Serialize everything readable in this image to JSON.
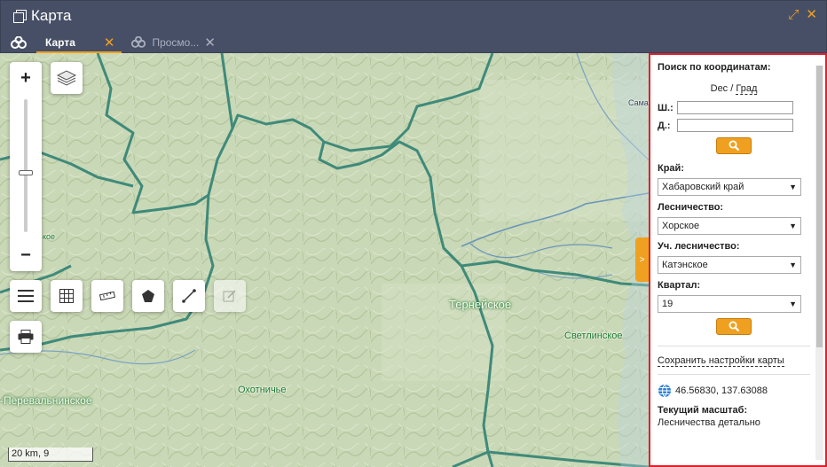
{
  "window": {
    "title": "Карта",
    "maximize_icon": "maximize-icon",
    "close_icon": "close-icon"
  },
  "tabs": [
    {
      "label": "Карта",
      "active": true
    },
    {
      "label": "Просмо...",
      "active": false
    }
  ],
  "map": {
    "places": {
      "ternejskoe": "Тернейское",
      "svetlinskoe": "Светлинское",
      "okhotnichye": "Охотничье",
      "perevalninskoe": "-Перевальнинское",
      "samarginskoe": "Самаргинс",
      "left_fragment": "кое"
    },
    "scale_label": "20 km, 9",
    "zoom_in": "+",
    "zoom_out": "−",
    "colors": {
      "terrain": "#c9d8b6",
      "boundary": "#3f8a7a",
      "river": "#6a97b8"
    }
  },
  "panel": {
    "coord_search_title": "Поиск по координатам:",
    "format_dec": "Dec",
    "format_sep": "/",
    "format_grad": "Град",
    "lat_label": "Ш.:",
    "lon_label": "Д.:",
    "lat_value": "",
    "lon_value": "",
    "region_label": "Край:",
    "region_value": "Хабаровский край",
    "forestry_label": "Лесничество:",
    "forestry_value": "Хорское",
    "district_label": "Уч. лесничество:",
    "district_value": "Катэнское",
    "quarter_label": "Квартал:",
    "quarter_value": "19",
    "save_settings": "Сохранить настройки карты",
    "cursor_coords": "46.56830, 137.63088",
    "current_scale_label": "Текущий масштаб:",
    "current_scale_value": "Лесничества детально",
    "toggle_label": ">",
    "accent": "#f0a020",
    "highlight_border": "#e0202a"
  }
}
